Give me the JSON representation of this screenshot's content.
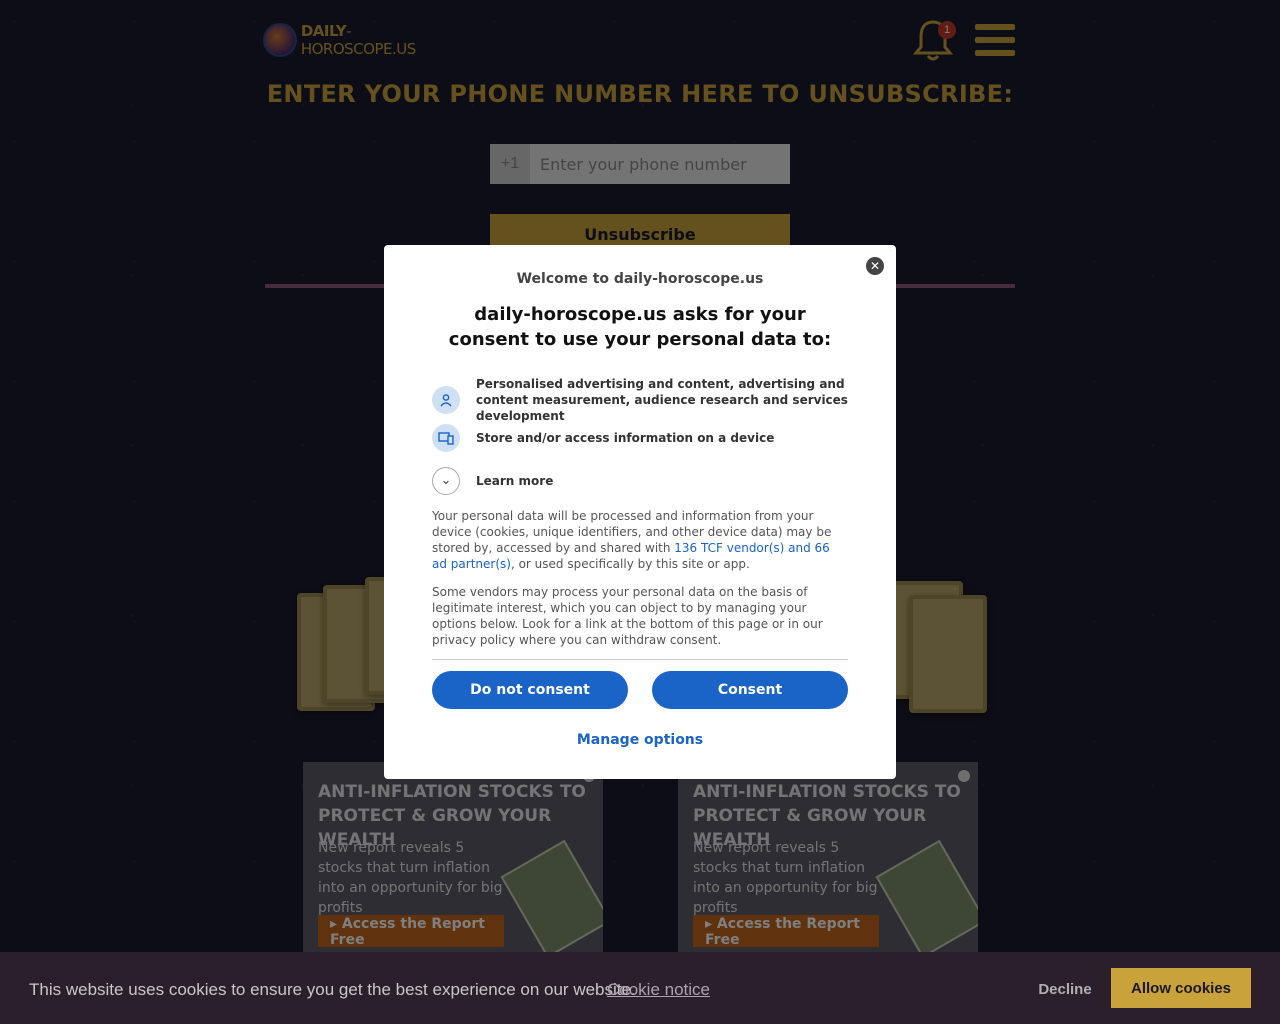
{
  "header": {
    "logo_bold": "DAILY",
    "logo_rest": "-HOROSCOPE.US",
    "notification_count": "1"
  },
  "unsubscribe": {
    "headline": "ENTER YOUR PHONE NUMBER HERE TO UNSUBSCRIBE:",
    "country_code": "+1",
    "phone_placeholder": "Enter your phone number",
    "button_label": "Unsubscribe"
  },
  "ads": [
    {
      "title": "ANTI-INFLATION STOCKS TO PROTECT & GROW YOUR WEALTH",
      "text": "New report reveals 5 stocks that turn inflation into an opportunity for big profits",
      "button": "Access the Report Free"
    },
    {
      "title": "ANTI-INFLATION STOCKS TO PROTECT & GROW YOUR WEALTH",
      "text": "New report reveals 5 stocks that turn inflation into an opportunity for big profits",
      "button": "Access the Report Free"
    }
  ],
  "consent": {
    "welcome": "Welcome to daily-horoscope.us",
    "title": "daily-horoscope.us asks for your consent to use your personal data to:",
    "purposes": [
      {
        "icon": "person-icon",
        "text": "Personalised advertising and content, advertising and content measurement, audience research and services development"
      },
      {
        "icon": "devices-icon",
        "text": "Store and/or access information on a device"
      }
    ],
    "learn_more": "Learn more",
    "para1_start": "Your personal data will be processed and information from your device (cookies, unique identifiers, and other device data) may be stored by, accessed by and shared with ",
    "para1_link": "136 TCF vendor(s) and 66 ad partner(s)",
    "para1_end": ", or used specifically by this site or app.",
    "para2": "Some vendors may process your personal data on the basis of legitimate interest, which you can object to by managing your options below. Look for a link at the bottom of this page or in our privacy policy where you can withdraw consent.",
    "do_not_consent": "Do not consent",
    "consent": "Consent",
    "manage_options": "Manage options",
    "close_symbol": "✕"
  },
  "cookie_bar": {
    "text": "This website uses cookies to ensure you get the best experience on our website.",
    "link": "Cookie notice",
    "decline": "Decline",
    "allow": "Allow cookies"
  },
  "colors": {
    "gold": "#c9a23a",
    "background": "#1b1a2e",
    "consent_blue": "#1a63c7"
  }
}
